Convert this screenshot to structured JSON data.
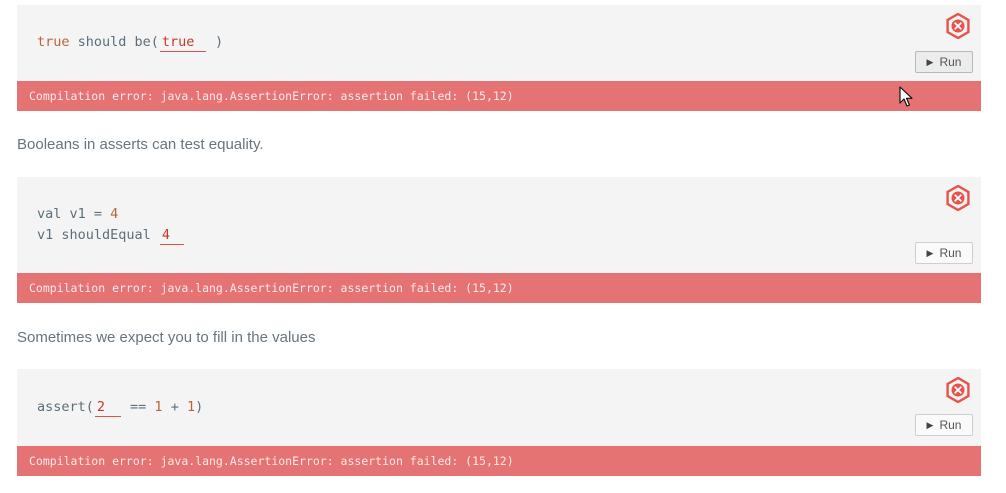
{
  "exercises": [
    {
      "code_before": "true",
      "code_mid": " should be(",
      "blank_value": "true",
      "code_after": " )",
      "run_label": "Run",
      "error": "Compilation error: java.lang.AssertionError: assertion failed: (15,12)"
    },
    {
      "line1_a": "val v1 = ",
      "line1_num": "4",
      "line2_a": "v1 shouldEqual ",
      "blank_value": "4",
      "run_label": "Run",
      "error": "Compilation error: java.lang.AssertionError: assertion failed: (15,12)"
    },
    {
      "code_before": "assert(",
      "blank_value": "2",
      "code_mid": " == ",
      "num1": "1",
      "plus": " + ",
      "num2": "1",
      "code_after": ")",
      "run_label": "Run",
      "error": "Compilation error: java.lang.AssertionError: assertion failed: (15,12)"
    }
  ],
  "descriptions": [
    "Booleans in asserts can test equality.",
    "Sometimes we expect you to fill in the values"
  ],
  "icons": {
    "close": "close-icon",
    "play": "play-icon",
    "cursor": "mouse-cursor-icon"
  },
  "colors": {
    "error_bar": "#e57373",
    "code_bg": "#f4f4f4",
    "close_icon": "#e5534b",
    "keyword": "#b5673a"
  }
}
